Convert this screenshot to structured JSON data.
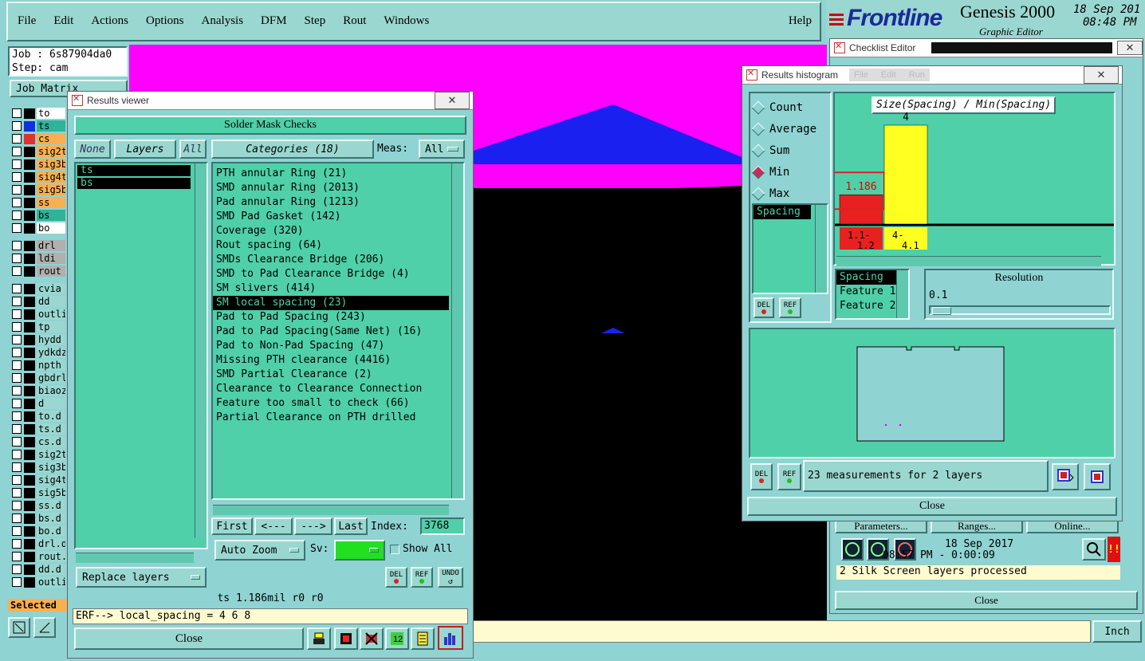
{
  "menubar": {
    "items": [
      "File",
      "Edit",
      "Actions",
      "Options",
      "Analysis",
      "DFM",
      "Step",
      "Rout",
      "Windows"
    ],
    "help": "Help"
  },
  "brand": {
    "logo": "Frontline",
    "product": "Genesis 2000",
    "subtitle": "Graphic Editor",
    "date": "18 Sep 201",
    "time": "08:48 PM"
  },
  "job": {
    "job_label": "Job : 6s87904da0",
    "step_label": "Step: cam",
    "matrix_button": "Job Matrix"
  },
  "layers": [
    {
      "name": "to",
      "color": "#000000",
      "bg": "#ffffff"
    },
    {
      "name": "ts",
      "color": "#1030e0",
      "bg": "#2fb39a"
    },
    {
      "name": "cs",
      "color": "#e03030",
      "bg": "#f8b050"
    },
    {
      "name": "sig2t",
      "color": "#000000",
      "bg": "#f8b050"
    },
    {
      "name": "sig3b",
      "color": "#000000",
      "bg": "#f8b050"
    },
    {
      "name": "sig4t",
      "color": "#000000",
      "bg": "#f8b050"
    },
    {
      "name": "sig5b",
      "color": "#000000",
      "bg": "#f8b050"
    },
    {
      "name": "ss",
      "color": "#000000",
      "bg": "#f8b050"
    },
    {
      "name": "bs",
      "color": "#000000",
      "bg": "#2fb39a"
    },
    {
      "name": "bo",
      "color": "#000000",
      "bg": "#ffffff"
    },
    {
      "name": "drl",
      "color": "#000000",
      "bg": "#b0b0b0"
    },
    {
      "name": "ldi",
      "color": "#000000",
      "bg": "#b0b0b0"
    },
    {
      "name": "rout",
      "color": "#000000",
      "bg": "#b0b0b0"
    },
    {
      "name": "cvia",
      "color": "#000000",
      "bg": "#9ad7d0"
    },
    {
      "name": "dd",
      "color": "#000000",
      "bg": "#9ad7d0"
    },
    {
      "name": "outli",
      "color": "#000000",
      "bg": "#9ad7d0"
    },
    {
      "name": "tp",
      "color": "#000000",
      "bg": "#9ad7d0"
    },
    {
      "name": "hydd",
      "color": "#000000",
      "bg": "#9ad7d0"
    },
    {
      "name": "ydkdz",
      "color": "#000000",
      "bg": "#9ad7d0"
    },
    {
      "name": "npth",
      "color": "#000000",
      "bg": "#9ad7d0"
    },
    {
      "name": "gbdrl",
      "color": "#000000",
      "bg": "#9ad7d0"
    },
    {
      "name": "biaoz",
      "color": "#000000",
      "bg": "#9ad7d0"
    },
    {
      "name": "d",
      "color": "#000000",
      "bg": "#9ad7d0"
    },
    {
      "name": "to.d",
      "color": "#000000",
      "bg": "#9ad7d0"
    },
    {
      "name": "ts.d",
      "color": "#000000",
      "bg": "#9ad7d0"
    },
    {
      "name": "cs.d",
      "color": "#000000",
      "bg": "#9ad7d0"
    },
    {
      "name": "sig2t",
      "color": "#000000",
      "bg": "#9ad7d0"
    },
    {
      "name": "sig3b",
      "color": "#000000",
      "bg": "#9ad7d0"
    },
    {
      "name": "sig4t",
      "color": "#000000",
      "bg": "#9ad7d0"
    },
    {
      "name": "sig5b",
      "color": "#000000",
      "bg": "#9ad7d0"
    },
    {
      "name": "ss.d",
      "color": "#000000",
      "bg": "#9ad7d0"
    },
    {
      "name": "bs.d",
      "color": "#000000",
      "bg": "#9ad7d0"
    },
    {
      "name": "bo.d",
      "color": "#000000",
      "bg": "#9ad7d0"
    },
    {
      "name": "drl.d",
      "color": "#000000",
      "bg": "#9ad7d0"
    },
    {
      "name": "rout.",
      "color": "#000000",
      "bg": "#9ad7d0"
    },
    {
      "name": "dd.d",
      "color": "#000000",
      "bg": "#9ad7d0"
    },
    {
      "name": "outli",
      "color": "#000000",
      "bg": "#9ad7d0"
    }
  ],
  "selected_label": "Selected",
  "units_button": "Inch",
  "results_viewer": {
    "title": "Results viewer",
    "header": "Solder Mask Checks",
    "none_btn": "None",
    "layers_btn": "Layers",
    "all_btn": "All",
    "categories_btn": "Categories (18)",
    "meas_label": "Meas:",
    "meas_value": "All",
    "layer_items": [
      "ts",
      "bs"
    ],
    "categories": [
      "PTH annular Ring (21)",
      "SMD annular Ring (2013)",
      "Pad annular Ring (1213)",
      "SMD Pad Gasket (142)",
      "Coverage (320)",
      "Rout spacing (64)",
      "SMDs Clearance Bridge (206)",
      "SMD to Pad Clearance Bridge (4)",
      "SM slivers (414)",
      "SM local spacing (23)",
      "Pad to Pad Spacing (243)",
      "Pad to Pad Spacing(Same Net) (16)",
      "Pad to Non-Pad Spacing (47)",
      "Missing PTH clearance (4416)",
      "SMD Partial Clearance (2)",
      "Clearance to Clearance Connection",
      "Feature too small to check (66)",
      "Partial Clearance on PTH drilled"
    ],
    "selected_index": 9,
    "nav": {
      "first": "First",
      "prev": "<---",
      "next": "--->",
      "last": "Last",
      "index_label": "Index:",
      "index_value": "3768"
    },
    "auto_zoom": "Auto Zoom",
    "sv_label": "Sv:",
    "show_all": "Show All",
    "replace_layers": "Replace layers",
    "del": "DEL",
    "ref": "REF",
    "undo": "UNDO",
    "status": "ts 1.186mil  r0  r0",
    "erf": "ERF--> local_spacing = 4 6 8",
    "close": "Close"
  },
  "histogram": {
    "title": "Results histogram",
    "bg_menu": [
      "File",
      "Edit",
      "Run"
    ],
    "modes": [
      "Count",
      "Average",
      "Sum",
      "Min",
      "Max"
    ],
    "mode_selected": "Min",
    "chart_title": "Size(Spacing) / Min(Spacing)",
    "measure_item": "Spacing",
    "bars": [
      {
        "label_top": "1.1-",
        "label_bottom": "1.2",
        "value": 1.186,
        "value_text": "1.186",
        "color": "#e82020"
      },
      {
        "label_top": "4-",
        "label_bottom": "4.1",
        "value": 4,
        "value_text": "4",
        "color": "#ffff20"
      }
    ],
    "feature_list": [
      "Spacing",
      "Feature 1",
      "Feature 2"
    ],
    "resolution_label": "Resolution",
    "resolution_value": "0.1",
    "summary": "23 measurements for 2 layers",
    "del": "DEL",
    "ref": "REF",
    "close": "Close"
  },
  "checklist": {
    "title": "Checklist Editor",
    "buttons": [
      "Parameters...",
      "Ranges...",
      "Online..."
    ],
    "date": "18 Sep 2017",
    "time": "08:57 PM - 0:00:09",
    "status": "2 Silk Screen layers processed",
    "close": "Close"
  }
}
